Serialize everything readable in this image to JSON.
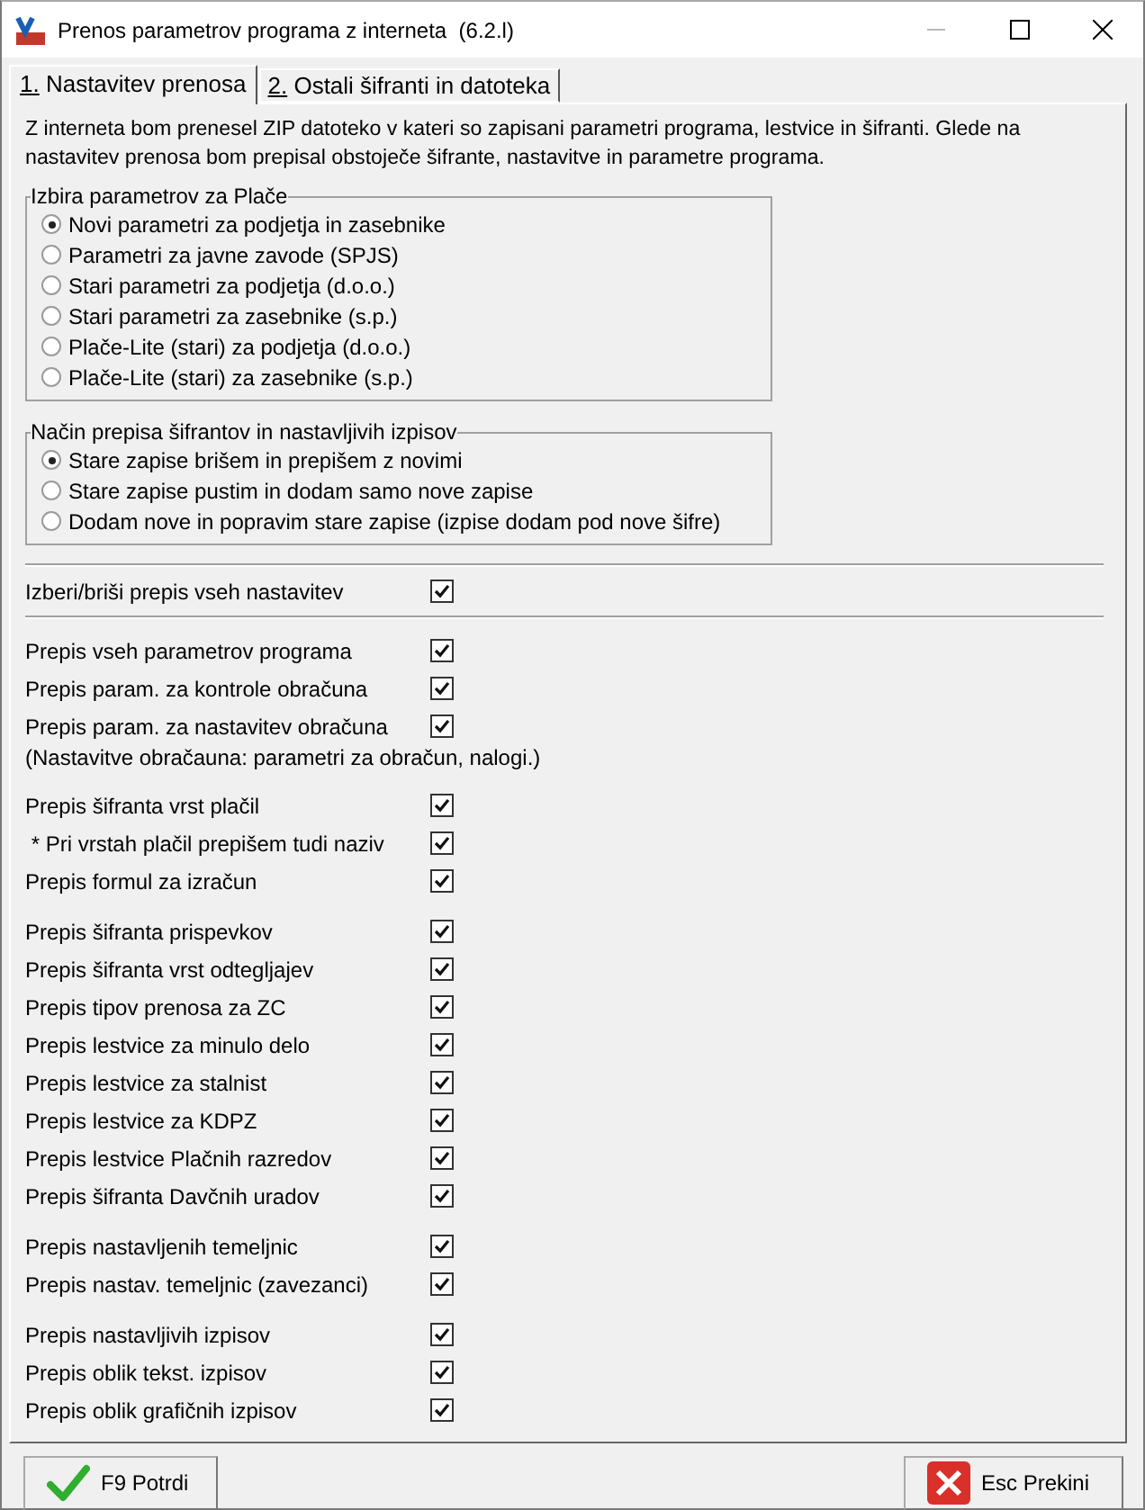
{
  "window": {
    "title": "Prenos parametrov programa z interneta  (6.2.l)"
  },
  "tabs": [
    {
      "label": "1. Nastavitev prenosa",
      "selected": true
    },
    {
      "label": "2. Ostali šifranti in datoteka",
      "selected": false
    }
  ],
  "intro": "Z interneta bom prenesel ZIP datoteko v kateri so zapisani parametri programa, lestvice in šifranti. Glede na nastavitev prenosa bom prepisal obstoječe šifrante, nastavitve in parametre programa.",
  "radio_groups": [
    {
      "title": "Izbira parametrov za Plače",
      "options": [
        {
          "label": "Novi parametri za podjetja in zasebnike",
          "selected": true
        },
        {
          "label": "Parametri za javne zavode (SPJS)",
          "selected": false
        },
        {
          "label": "Stari parametri za podjetja (d.o.o.)",
          "selected": false
        },
        {
          "label": "Stari parametri za zasebnike (s.p.)",
          "selected": false
        },
        {
          "label": "Plače-Lite (stari) za podjetja (d.o.o.)",
          "selected": false
        },
        {
          "label": "Plače-Lite (stari) za zasebnike (s.p.)",
          "selected": false
        }
      ]
    },
    {
      "title": "Način prepisa šifrantov in nastavljivih izpisov",
      "options": [
        {
          "label": "Stare zapise brišem in prepišem z novimi",
          "selected": true
        },
        {
          "label": "Stare zapise pustim in dodam samo nove zapise",
          "selected": false
        },
        {
          "label": "Dodam nove in popravim stare zapise (izpise dodam pod nove šifre)",
          "selected": false
        }
      ]
    }
  ],
  "select_all": {
    "label": "Izberi/briši prepis vseh nastavitev",
    "checked": true
  },
  "option_groups": [
    {
      "items": [
        {
          "kind": "check",
          "label": "Prepis vseh parametrov programa",
          "checked": true
        },
        {
          "kind": "check",
          "label": "Prepis param. za kontrole obračuna",
          "checked": true
        },
        {
          "kind": "check",
          "label": "Prepis param. za nastavitev obračuna",
          "checked": true
        },
        {
          "kind": "note",
          "label": "(Nastavitve obračauna: parametri za obračun, nalogi.)"
        }
      ]
    },
    {
      "items": [
        {
          "kind": "check",
          "label": "Prepis šifranta vrst plačil",
          "checked": true
        },
        {
          "kind": "check",
          "label": " * Pri vrstah plačil prepišem tudi naziv",
          "checked": true
        },
        {
          "kind": "check",
          "label": "Prepis formul za izračun",
          "checked": true
        }
      ]
    },
    {
      "items": [
        {
          "kind": "check",
          "label": "Prepis šifranta prispevkov",
          "checked": true
        },
        {
          "kind": "check",
          "label": "Prepis šifranta vrst odtegljajev",
          "checked": true
        },
        {
          "kind": "check",
          "label": "Prepis tipov prenosa za ZC",
          "checked": true
        },
        {
          "kind": "check",
          "label": "Prepis lestvice za minulo delo",
          "checked": true
        },
        {
          "kind": "check",
          "label": "Prepis lestvice za stalnist",
          "checked": true
        },
        {
          "kind": "check",
          "label": "Prepis lestvice za KDPZ",
          "checked": true
        },
        {
          "kind": "check",
          "label": "Prepis lestvice Plačnih razredov",
          "checked": true
        },
        {
          "kind": "check",
          "label": "Prepis šifranta Davčnih uradov",
          "checked": true
        }
      ]
    },
    {
      "items": [
        {
          "kind": "check",
          "label": "Prepis nastavljenih temeljnic",
          "checked": true
        },
        {
          "kind": "check",
          "label": "Prepis nastav. temeljnic (zavezanci)",
          "checked": true
        }
      ]
    },
    {
      "items": [
        {
          "kind": "check",
          "label": "Prepis nastavljivih izpisov",
          "checked": true
        },
        {
          "kind": "check",
          "label": "Prepis oblik tekst. izpisov",
          "checked": true
        },
        {
          "kind": "check",
          "label": "Prepis oblik grafičnih izpisov",
          "checked": true
        }
      ]
    }
  ],
  "buttons": [
    {
      "kind": "confirm",
      "label": "F9 Potrdi"
    },
    {
      "kind": "cancel",
      "label": "Esc Prekini"
    }
  ]
}
